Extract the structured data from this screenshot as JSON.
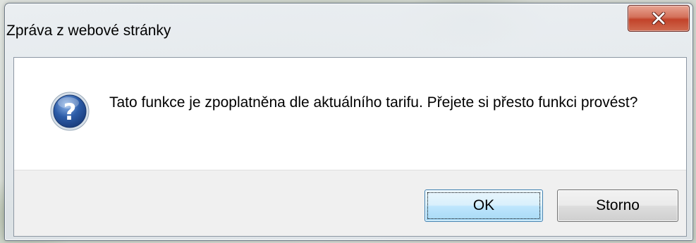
{
  "window": {
    "title": "Zpráva z webové stránky",
    "close_icon": "close-icon"
  },
  "dialog": {
    "icon": "question-icon",
    "message": "Tato funkce je zpoplatněna dle aktuálního tarifu. Přejete si přesto funkci provést?"
  },
  "buttons": {
    "ok_label": "OK",
    "cancel_label": "Storno"
  },
  "colors": {
    "close_button": "#c2432a",
    "icon_blue": "#2c5ca8",
    "ok_border": "#3c7fb1"
  }
}
